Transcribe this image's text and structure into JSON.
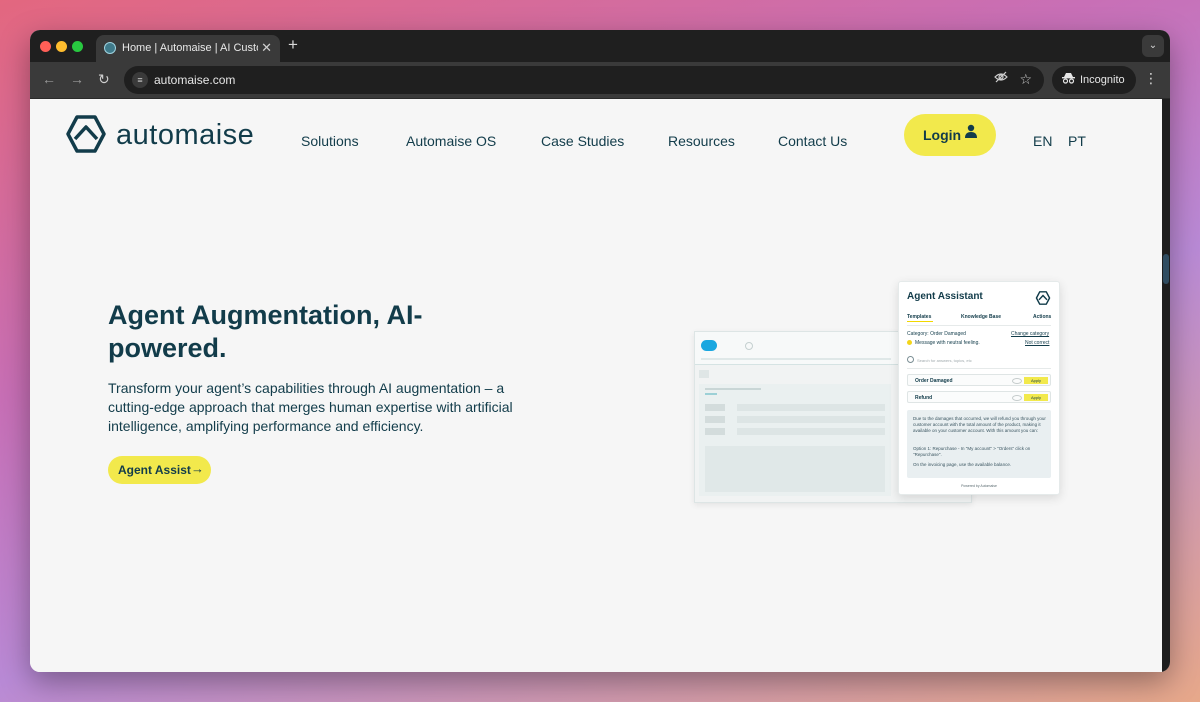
{
  "browser": {
    "tab_title": "Home | Automaise | AI Custo",
    "tab_close": "✕",
    "new_tab": "+",
    "tab_menu": "⌄",
    "url": "automaise.com",
    "incognito_label": "Incognito",
    "icons": [
      "back-arrow-icon",
      "forward-arrow-icon",
      "reload-icon",
      "site-settings-icon",
      "eye-off-icon",
      "star-icon",
      "incognito-icon",
      "kebab-menu-icon"
    ]
  },
  "header": {
    "logo_text": "automaise",
    "nav": [
      "Solutions",
      "Automaise OS",
      "Case Studies",
      "Resources",
      "Contact Us"
    ],
    "login_label": "Login",
    "languages": [
      "EN",
      "PT"
    ],
    "accent_color": "#f2e94c",
    "brand_color": "#123c4a"
  },
  "hero": {
    "title": "Agent Augmentation, AI-powered.",
    "description": "Transform your agent’s capabilities through AI augmentation – a cutting-edge approach that merges human expertise with artificial intelligence, amplifying performance and efficiency.",
    "cta_label": "Agent Assist",
    "cta_arrow": "→"
  },
  "illustration": {
    "crm_brand": "salesforce",
    "assistant": {
      "title": "Agent Assistant",
      "tabs": [
        "Templates",
        "Knowledge Base",
        "Actions"
      ],
      "category": "Category: Order Damaged",
      "change_category": "Change category",
      "sentiment": "Message with neutral feeling.",
      "not_correct": "Not correct",
      "search_placeholder": "Search for answers, topics, etc",
      "items": [
        {
          "label": "Order Damaged",
          "action": "Apply"
        },
        {
          "label": "Refund",
          "action": "Apply"
        }
      ],
      "message_p1": "Due to the damages that occurred, we will refund you through your customer account with the total amount of the product, making it available on your customer account. With this amount you can:",
      "message_p2": "Option 1: Repurchase - In \"My account\" > \"Orders\" click on \"Repurchase\".",
      "message_p3": "On the invoicing page, use the available balance.",
      "powered_by": "Powered by Automaise"
    }
  }
}
